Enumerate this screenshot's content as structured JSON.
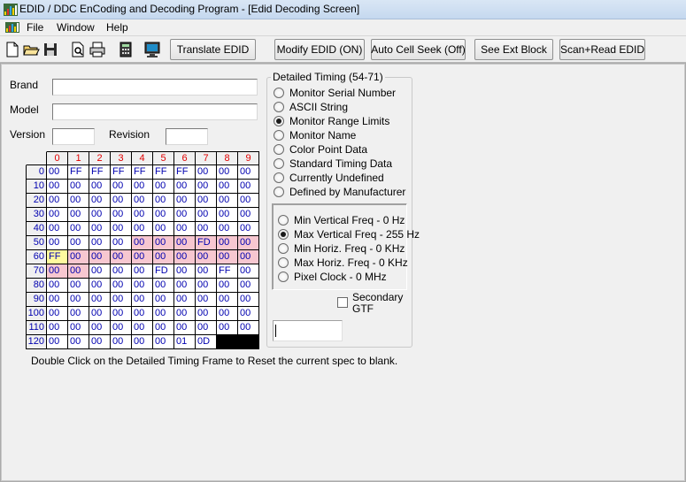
{
  "window": {
    "title": "EDID / DDC EnCoding and Decoding Program  - [Edid Decoding Screen]"
  },
  "menu": {
    "items": [
      "File",
      "Window",
      "Help"
    ]
  },
  "toolbar": {
    "icons": [
      "new-file-icon",
      "open-folder-icon",
      "save-icon",
      "print-preview-icon",
      "print-icon",
      "calculator-icon",
      "monitor-icon"
    ],
    "buttons": {
      "translate": "Translate EDID",
      "modify": "Modify EDID (ON)",
      "auto_cell_seek": "Auto Cell Seek (Off)",
      "see_ext_block": "See Ext Block",
      "scan_read": "Scan+Read EDID"
    }
  },
  "form": {
    "brand_label": "Brand",
    "brand_value": "",
    "model_label": "Model",
    "model_value": "",
    "version_label": "Version",
    "version_value": "",
    "revision_label": "Revision",
    "revision_value": ""
  },
  "grid": {
    "col_headers": [
      "0",
      "1",
      "2",
      "3",
      "4",
      "5",
      "6",
      "7",
      "8",
      "9"
    ],
    "row_headers": [
      "0",
      "10",
      "20",
      "30",
      "40",
      "50",
      "60",
      "70",
      "80",
      "90",
      "100",
      "110",
      "120"
    ],
    "rows": [
      [
        "00",
        "FF",
        "FF",
        "FF",
        "FF",
        "FF",
        "FF",
        "00",
        "00",
        "00"
      ],
      [
        "00",
        "00",
        "00",
        "00",
        "00",
        "00",
        "00",
        "00",
        "00",
        "00"
      ],
      [
        "00",
        "00",
        "00",
        "00",
        "00",
        "00",
        "00",
        "00",
        "00",
        "00"
      ],
      [
        "00",
        "00",
        "00",
        "00",
        "00",
        "00",
        "00",
        "00",
        "00",
        "00"
      ],
      [
        "00",
        "00",
        "00",
        "00",
        "00",
        "00",
        "00",
        "00",
        "00",
        "00"
      ],
      [
        "00",
        "00",
        "00",
        "00",
        "00",
        "00",
        "00",
        "FD",
        "00",
        "00"
      ],
      [
        "FF",
        "00",
        "00",
        "00",
        "00",
        "00",
        "00",
        "00",
        "00",
        "00"
      ],
      [
        "00",
        "00",
        "00",
        "00",
        "00",
        "FD",
        "00",
        "00",
        "FF",
        "00"
      ],
      [
        "00",
        "00",
        "00",
        "00",
        "00",
        "00",
        "00",
        "00",
        "00",
        "00"
      ],
      [
        "00",
        "00",
        "00",
        "00",
        "00",
        "00",
        "00",
        "00",
        "00",
        "00"
      ],
      [
        "00",
        "00",
        "00",
        "00",
        "00",
        "00",
        "00",
        "00",
        "00",
        "00"
      ],
      [
        "00",
        "00",
        "00",
        "00",
        "00",
        "00",
        "00",
        "00",
        "00",
        "00"
      ],
      [
        "00",
        "00",
        "00",
        "00",
        "00",
        "00",
        "01",
        "0D",
        "",
        ""
      ]
    ],
    "highlight": {
      "yellow": [
        [
          6,
          0
        ]
      ],
      "pink": [
        [
          5,
          4
        ],
        [
          5,
          5
        ],
        [
          5,
          6
        ],
        [
          5,
          7
        ],
        [
          5,
          8
        ],
        [
          5,
          9
        ],
        [
          6,
          1
        ],
        [
          6,
          2
        ],
        [
          6,
          3
        ],
        [
          6,
          4
        ],
        [
          6,
          5
        ],
        [
          6,
          6
        ],
        [
          6,
          7
        ],
        [
          6,
          8
        ],
        [
          6,
          9
        ],
        [
          7,
          0
        ],
        [
          7,
          1
        ]
      ],
      "black": [
        [
          12,
          8
        ],
        [
          12,
          9
        ]
      ]
    }
  },
  "detailed_timing": {
    "title": "Detailed Timing (54-71)",
    "options": [
      {
        "label": "Monitor Serial Number",
        "selected": false
      },
      {
        "label": "ASCII String",
        "selected": false
      },
      {
        "label": "Monitor Range Limits",
        "selected": true
      },
      {
        "label": "Monitor Name",
        "selected": false
      },
      {
        "label": "Color Point Data",
        "selected": false
      },
      {
        "label": "Standard Timing Data",
        "selected": false
      },
      {
        "label": "Currently Undefined",
        "selected": false
      },
      {
        "label": "Defined by Manufacturer",
        "selected": false
      }
    ],
    "range_options": [
      {
        "label": "Min Vertical Freq - 0 Hz",
        "selected": false
      },
      {
        "label": "Max Vertical Freq - 255 Hz",
        "selected": true
      },
      {
        "label": "Min Horiz. Freq - 0 KHz",
        "selected": false
      },
      {
        "label": "Max Horiz. Freq - 0 KHz",
        "selected": false
      },
      {
        "label": "Pixel Clock  - 0 MHz",
        "selected": false
      }
    ],
    "secondary_gtf_line1": "Secondary",
    "secondary_gtf_line2": "GTF",
    "secondary_gtf_checked": false,
    "value_input": ""
  },
  "hint_text": "Double Click on the Detailed Timing Frame to Reset the current spec to blank."
}
